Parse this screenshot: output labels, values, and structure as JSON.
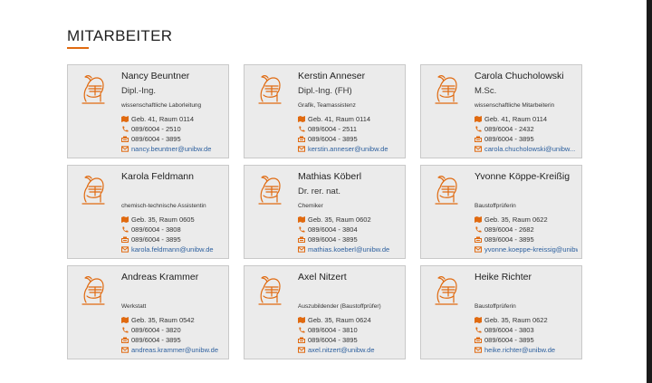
{
  "heading": "MITARBEITER",
  "colors": {
    "accent": "#e06a10",
    "link": "#2c5f9e",
    "card_bg": "#ebebeb"
  },
  "icons": {
    "avatar": "knight-helmet-icon",
    "room": "map-icon",
    "phone": "phone-icon",
    "fax": "fax-icon",
    "email": "envelope-icon"
  },
  "employees": [
    {
      "name": "Nancy Beuntner",
      "title": "Dipl.-Ing.",
      "role": "wissenschaftliche Laborleitung",
      "room": "Geb. 41, Raum 0114",
      "phone": "089/6004 - 2510",
      "fax": "089/6004 - 3895",
      "email": "nancy.beuntner@unibw.de"
    },
    {
      "name": "Kerstin Anneser",
      "title": "Dipl.-Ing. (FH)",
      "role": "Grafik, Teamassistenz",
      "room": "Geb. 41, Raum 0114",
      "phone": "089/6004 - 2511",
      "fax": "089/6004 - 3895",
      "email": "kerstin.anneser@unibw.de"
    },
    {
      "name": "Carola Chucholowski",
      "title": "M.Sc.",
      "role": "wissenschaftliche Mitarbeiterin",
      "room": "Geb. 41, Raum 0114",
      "phone": "089/6004 - 2432",
      "fax": "089/6004 - 3895",
      "email": "carola.chucholowski@unibw..."
    },
    {
      "name": "Karola Feldmann",
      "title": "",
      "role": "chemisch-technische Assistentin",
      "room": "Geb. 35, Raum 0605",
      "phone": "089/6004 - 3808",
      "fax": "089/6004 - 3895",
      "email": "karola.feldmann@unibw.de"
    },
    {
      "name": "Mathias Köberl",
      "title": "Dr. rer. nat.",
      "role": "Chemiker",
      "room": "Geb. 35, Raum 0602",
      "phone": "089/6004 - 3804",
      "fax": "089/6004 - 3895",
      "email": "mathias.koeberl@unibw.de"
    },
    {
      "name": "Yvonne Köppe-Kreißig",
      "title": "",
      "role": "Baustoffprüferin",
      "room": "Geb. 35, Raum 0622",
      "phone": "089/6004 - 2682",
      "fax": "089/6004 - 3895",
      "email": "yvonne.koeppe-kreissig@unibw."
    },
    {
      "name": "Andreas Krammer",
      "title": "",
      "role": "Werkstatt",
      "room": "Geb. 35, Raum 0542",
      "phone": "089/6004 - 3820",
      "fax": "089/6004 - 3895",
      "email": "andreas.krammer@unibw.de"
    },
    {
      "name": "Axel Nitzert",
      "title": "",
      "role": "Auszubildender (Baustoffprüfer)",
      "room": "Geb. 35, Raum 0624",
      "phone": "089/6004 - 3810",
      "fax": "089/6004 - 3895",
      "email": "axel.nitzert@unibw.de"
    },
    {
      "name": "Heike Richter",
      "title": "",
      "role": "Baustoffprüferin",
      "room": "Geb. 35, Raum 0622",
      "phone": "089/6004 - 3803",
      "fax": "089/6004 - 3895",
      "email": "heike.richter@unibw.de"
    }
  ]
}
